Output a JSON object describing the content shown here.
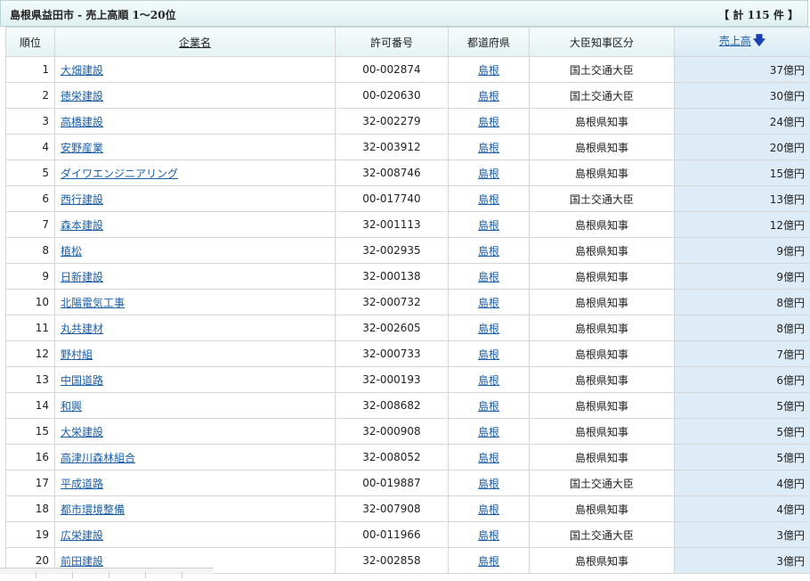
{
  "header": {
    "title": "島根県益田市 - 売上高順 1～20位",
    "count": "【 計 115 件 】"
  },
  "columns": {
    "rank": "順位",
    "name": "企業名",
    "permit": "許可番号",
    "pref": "都道府県",
    "authority": "大臣知事区分",
    "sales": "売上高"
  },
  "sort_icon": "arrow-down-icon",
  "colors": {
    "link": "#1a5ea8",
    "sales_bg": "#deecf7",
    "header_bg": "#e4f2f2"
  },
  "rows": [
    {
      "rank": "1",
      "name": "大畑建設",
      "permit": "00-002874",
      "pref": "島根",
      "authority": "国土交通大臣",
      "sales": "37億円"
    },
    {
      "rank": "2",
      "name": "徳栄建設",
      "permit": "00-020630",
      "pref": "島根",
      "authority": "国土交通大臣",
      "sales": "30億円"
    },
    {
      "rank": "3",
      "name": "高橋建設",
      "permit": "32-002279",
      "pref": "島根",
      "authority": "島根県知事",
      "sales": "24億円"
    },
    {
      "rank": "4",
      "name": "安野産業",
      "permit": "32-003912",
      "pref": "島根",
      "authority": "島根県知事",
      "sales": "20億円"
    },
    {
      "rank": "5",
      "name": "ダイワエンジニアリング",
      "permit": "32-008746",
      "pref": "島根",
      "authority": "島根県知事",
      "sales": "15億円"
    },
    {
      "rank": "6",
      "name": "西行建設",
      "permit": "00-017740",
      "pref": "島根",
      "authority": "国土交通大臣",
      "sales": "13億円"
    },
    {
      "rank": "7",
      "name": "森本建設",
      "permit": "32-001113",
      "pref": "島根",
      "authority": "島根県知事",
      "sales": "12億円"
    },
    {
      "rank": "8",
      "name": "植松",
      "permit": "32-002935",
      "pref": "島根",
      "authority": "島根県知事",
      "sales": "9億円"
    },
    {
      "rank": "9",
      "name": "日新建設",
      "permit": "32-000138",
      "pref": "島根",
      "authority": "島根県知事",
      "sales": "9億円"
    },
    {
      "rank": "10",
      "name": "北陽電気工事",
      "permit": "32-000732",
      "pref": "島根",
      "authority": "島根県知事",
      "sales": "8億円"
    },
    {
      "rank": "11",
      "name": "丸共建材",
      "permit": "32-002605",
      "pref": "島根",
      "authority": "島根県知事",
      "sales": "8億円"
    },
    {
      "rank": "12",
      "name": "野村組",
      "permit": "32-000733",
      "pref": "島根",
      "authority": "島根県知事",
      "sales": "7億円"
    },
    {
      "rank": "13",
      "name": "中国道路",
      "permit": "32-000193",
      "pref": "島根",
      "authority": "島根県知事",
      "sales": "6億円"
    },
    {
      "rank": "14",
      "name": "和興",
      "permit": "32-008682",
      "pref": "島根",
      "authority": "島根県知事",
      "sales": "5億円"
    },
    {
      "rank": "15",
      "name": "大栄建設",
      "permit": "32-000908",
      "pref": "島根",
      "authority": "島根県知事",
      "sales": "5億円"
    },
    {
      "rank": "16",
      "name": "高津川森林組合",
      "permit": "32-008052",
      "pref": "島根",
      "authority": "島根県知事",
      "sales": "5億円"
    },
    {
      "rank": "17",
      "name": "平成道路",
      "permit": "00-019887",
      "pref": "島根",
      "authority": "国土交通大臣",
      "sales": "4億円"
    },
    {
      "rank": "18",
      "name": "都市環境整備",
      "permit": "32-007908",
      "pref": "島根",
      "authority": "島根県知事",
      "sales": "4億円"
    },
    {
      "rank": "19",
      "name": "広栄建設",
      "permit": "00-011966",
      "pref": "島根",
      "authority": "国土交通大臣",
      "sales": "3億円"
    },
    {
      "rank": "20",
      "name": "前田建設",
      "permit": "32-002858",
      "pref": "島根",
      "authority": "島根県知事",
      "sales": "3億円"
    }
  ]
}
